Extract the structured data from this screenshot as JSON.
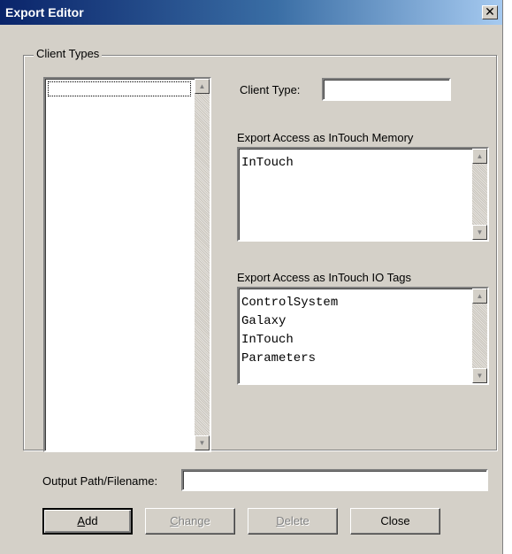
{
  "window": {
    "title": "Export Editor",
    "close_glyph": "✕"
  },
  "group": {
    "label": "Client Types"
  },
  "client_types_list": {
    "items": []
  },
  "client_type": {
    "label": "Client Type:",
    "value": ""
  },
  "memory": {
    "label": "Export Access as InTouch Memory",
    "items": [
      "InTouch"
    ]
  },
  "io_tags": {
    "label": "Export Access as InTouch IO Tags",
    "items": [
      "ControlSystem",
      "Galaxy",
      "InTouch",
      "Parameters"
    ]
  },
  "output": {
    "label": "Output Path/Filename:",
    "value": ""
  },
  "buttons": {
    "add": {
      "mnemonic": "A",
      "rest": "dd",
      "enabled": true
    },
    "change": {
      "mnemonic": "C",
      "rest": "hange",
      "enabled": false
    },
    "delete": {
      "mnemonic": "D",
      "rest": "elete",
      "enabled": false
    },
    "close": {
      "label": "Close",
      "enabled": true
    }
  },
  "icons": {
    "scroll_up": "scroll-up-arrow-icon",
    "scroll_down": "scroll-down-arrow-icon",
    "close": "close-icon"
  }
}
